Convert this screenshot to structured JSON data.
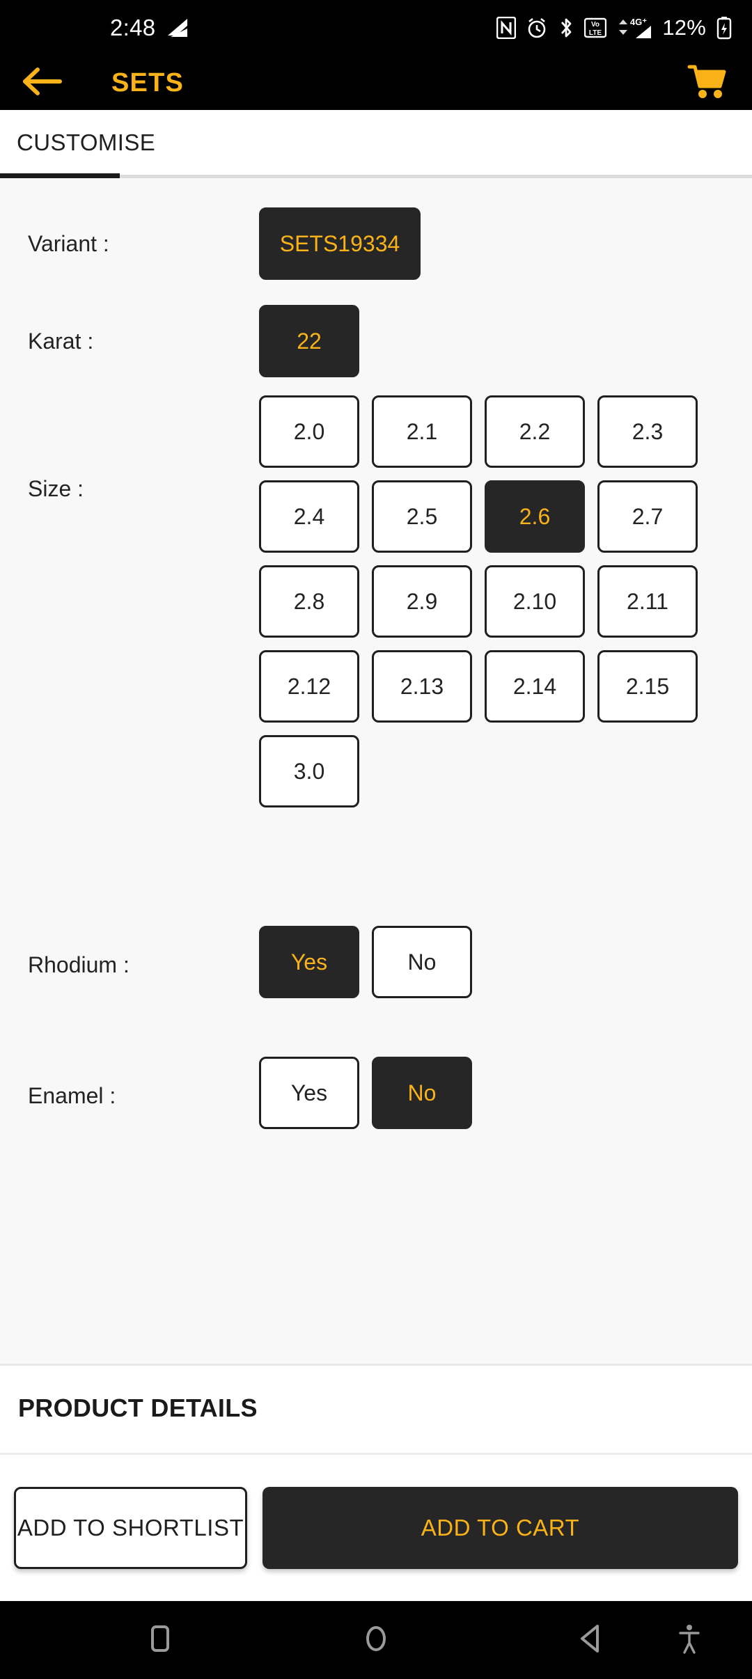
{
  "theme": {
    "accent": "#f9b319",
    "chip_selected_bg": "#262626",
    "app_bar_bg": "#000000",
    "content_bg": "#f8f8f8"
  },
  "status_bar": {
    "time": "2:48",
    "battery_percent": "12%",
    "icons": [
      "signal-wave-icon",
      "nfc-icon",
      "alarm-icon",
      "bluetooth-icon",
      "volte-icon",
      "network-4g-plus-icon",
      "battery-charging-icon"
    ]
  },
  "app_bar": {
    "back_icon": "arrow-left-icon",
    "title": "SETS",
    "cart_icon": "shopping-cart-icon"
  },
  "tabs": {
    "items": [
      {
        "label": "CUSTOMISE",
        "active": true
      }
    ]
  },
  "options": [
    {
      "id": "variant",
      "label": "Variant :",
      "values": [
        {
          "text": "SETS19334",
          "selected": true,
          "wide": true
        }
      ]
    },
    {
      "id": "karat",
      "label": "Karat :",
      "values": [
        {
          "text": "22",
          "selected": true,
          "wide": false
        }
      ]
    },
    {
      "id": "size",
      "label": "Size :",
      "values": [
        {
          "text": "2.0",
          "selected": false
        },
        {
          "text": "2.1",
          "selected": false
        },
        {
          "text": "2.2",
          "selected": false
        },
        {
          "text": "2.3",
          "selected": false
        },
        {
          "text": "2.4",
          "selected": false
        },
        {
          "text": "2.5",
          "selected": false
        },
        {
          "text": "2.6",
          "selected": true
        },
        {
          "text": "2.7",
          "selected": false
        },
        {
          "text": "2.8",
          "selected": false
        },
        {
          "text": "2.9",
          "selected": false
        },
        {
          "text": "2.10",
          "selected": false
        },
        {
          "text": "2.11",
          "selected": false
        },
        {
          "text": "2.12",
          "selected": false
        },
        {
          "text": "2.13",
          "selected": false
        },
        {
          "text": "2.14",
          "selected": false
        },
        {
          "text": "2.15",
          "selected": false
        },
        {
          "text": "3.0",
          "selected": false
        }
      ]
    },
    {
      "id": "rhodium",
      "label": "Rhodium :",
      "values": [
        {
          "text": "Yes",
          "selected": true
        },
        {
          "text": "No",
          "selected": false
        }
      ]
    },
    {
      "id": "enamel",
      "label": "Enamel :",
      "values": [
        {
          "text": "Yes",
          "selected": false
        },
        {
          "text": "No",
          "selected": true
        }
      ]
    }
  ],
  "product_details": {
    "title": "PRODUCT DETAILS"
  },
  "actions": {
    "shortlist_label": "ADD TO SHORTLIST",
    "cart_label": "ADD TO CART"
  },
  "nav_bar": {
    "recents_icon": "square-recents-icon",
    "home_icon": "circle-home-icon",
    "back_icon": "triangle-back-icon",
    "accessibility_icon": "accessibility-icon"
  }
}
